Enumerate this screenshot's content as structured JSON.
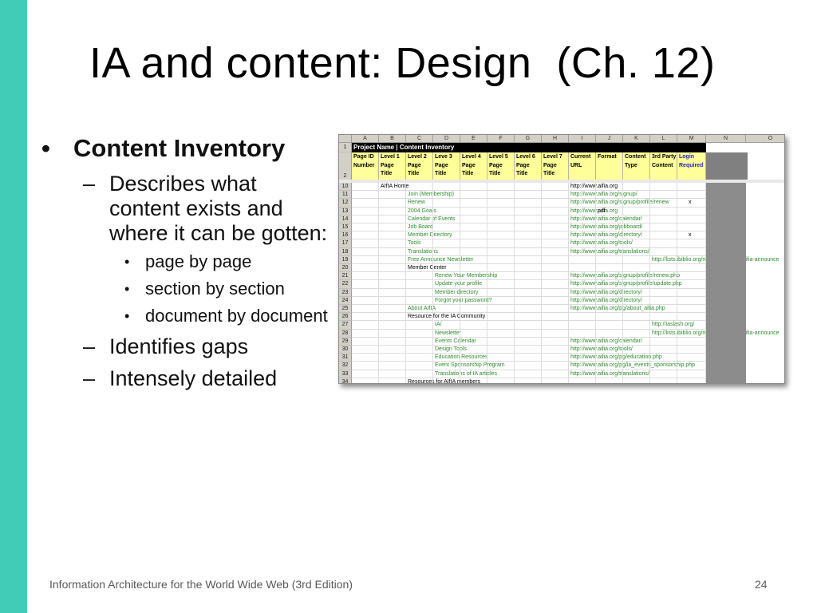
{
  "slide": {
    "title": "IA and content: Design  (Ch. 12)",
    "footer": "Information Architecture for the World Wide Web (3rd Edition)",
    "page_number": "24",
    "accent_color": "#40CCB6"
  },
  "bullets": {
    "l1": "Content Inventory",
    "describes": "Describes what content exists and where it can be gotten:",
    "sub1": "page by page",
    "sub2": "section by section",
    "sub3": "document by document",
    "gaps": "Identifies gaps",
    "detailed": "Intensely detailed"
  },
  "spreadsheet": {
    "columns": [
      "A",
      "B",
      "C",
      "D",
      "E",
      "F",
      "G",
      "H",
      "I",
      "J",
      "K",
      "L",
      "M",
      "N",
      "O"
    ],
    "banner": "Project Name | Content Inventory",
    "headers": [
      [
        "Page ID",
        "Number",
        ""
      ],
      [
        "Level 1",
        "Page",
        "Title"
      ],
      [
        "Level 2",
        "Page",
        "Title"
      ],
      [
        "Leve 3",
        "Page",
        "Title"
      ],
      [
        "Level 4",
        "Page",
        "Title"
      ],
      [
        "Level 5",
        "Page",
        "Title"
      ],
      [
        "Level 6",
        "Page",
        "Title"
      ],
      [
        "Level 7",
        "Page",
        "Title"
      ],
      [
        "Current",
        "URL",
        ""
      ],
      [
        "Format",
        "",
        ""
      ],
      [
        "Content",
        "Type",
        ""
      ],
      [
        "3rd Party",
        "Content",
        ""
      ],
      [
        "Login",
        "Required",
        ""
      ]
    ],
    "header_row_labels": [
      "1",
      "2"
    ],
    "rows": [
      {
        "n": "10",
        "level": 1,
        "title": "AIfIA Home",
        "url": "http://www.aifia.org",
        "fmt": "",
        "login": ""
      },
      {
        "n": "11",
        "level": 2,
        "title": "Join (Membership)",
        "url": "http://www.aifia.org/signup/",
        "fmt": "",
        "login": ""
      },
      {
        "n": "12",
        "level": 2,
        "title": "Renew",
        "url": "http://www.aifia.org/signup/profile/renew",
        "fmt": "",
        "login": "x"
      },
      {
        "n": "13",
        "level": 2,
        "title": "2004 Goals",
        "url": "http://www.aifia.org",
        "fmt": "pdf",
        "login": ""
      },
      {
        "n": "14",
        "level": 2,
        "title": "Calendar of Events",
        "url": "http://www.aifia.org/calendar/",
        "fmt": "",
        "login": ""
      },
      {
        "n": "15",
        "level": 2,
        "title": "Job Board",
        "url": "http://www.aifia.org/jobboard/",
        "fmt": "",
        "login": ""
      },
      {
        "n": "16",
        "level": 2,
        "title": "Member Directory",
        "url": "http://www.aifia.org/directory/",
        "fmt": "",
        "login": "x"
      },
      {
        "n": "17",
        "level": 2,
        "title": "Tools",
        "url": "http://www.aifia.org/tools/",
        "fmt": "",
        "login": ""
      },
      {
        "n": "18",
        "level": 2,
        "title": "Translations",
        "url": "http://www.aifia.org/translations/",
        "fmt": "",
        "login": ""
      },
      {
        "n": "19",
        "level": 2,
        "title": "Free Announce Newsletter",
        "url": "",
        "third": "http://lists.ibiblio.org/mailman/listinfo/aifia-announce",
        "fmt": "",
        "login": ""
      },
      {
        "n": "20",
        "level": 2,
        "title": "Member Center",
        "url": "",
        "fmt": "",
        "login": "",
        "black": true
      },
      {
        "n": "21",
        "level": 3,
        "title": "Renew Your Membership",
        "url": "http://www.aifia.org/signup/profile/renew.php",
        "fmt": "",
        "login": ""
      },
      {
        "n": "22",
        "level": 3,
        "title": "Update your profile",
        "url": "http://www.aifia.org/signup/profile/update.php",
        "fmt": "",
        "login": ""
      },
      {
        "n": "23",
        "level": 3,
        "title": "Member directory",
        "url": "http://www.aifia.org/directory/",
        "fmt": "",
        "login": ""
      },
      {
        "n": "24",
        "level": 3,
        "title": "Forgot your password?",
        "url": "http://www.aifia.org/directory/",
        "fmt": "",
        "login": ""
      },
      {
        "n": "25",
        "level": 2,
        "title": "About AIfIA",
        "url": "http://www.aifia.org/pg/about_aifia.php",
        "fmt": "",
        "login": ""
      },
      {
        "n": "26",
        "level": 2,
        "title": "Resource for the IA Community",
        "url": "",
        "fmt": "",
        "login": "",
        "black": true
      },
      {
        "n": "27",
        "level": 3,
        "title": "IA/",
        "url": "",
        "third": "http://iaslash.org/",
        "fmt": "",
        "login": ""
      },
      {
        "n": "28",
        "level": 3,
        "title": "Newsletter",
        "url": "",
        "third": "http://lists.ibiblio.org/mailman/listinfo/aifia-announce",
        "fmt": "",
        "login": ""
      },
      {
        "n": "29",
        "level": 3,
        "title": "Events Calendar",
        "url": "http://www.aifia.org/calendar/",
        "fmt": "",
        "login": ""
      },
      {
        "n": "30",
        "level": 3,
        "title": "Design Tools",
        "url": "http://www.aifia.org/tools/",
        "fmt": "",
        "login": ""
      },
      {
        "n": "31",
        "level": 3,
        "title": "Education Resources",
        "url": "http://www.aifia.org/pg/education.php",
        "fmt": "",
        "login": ""
      },
      {
        "n": "32",
        "level": 3,
        "title": "Event Sponsorship Program",
        "url": "http://www.aifia.org/pg/ia_events_sponsorship.php",
        "fmt": "",
        "login": ""
      },
      {
        "n": "33",
        "level": 3,
        "title": "Translations of IA articles",
        "url": "http://www.aifia.org/translations/",
        "fmt": "",
        "login": ""
      },
      {
        "n": "34",
        "level": 2,
        "title": "Resources for AIfIA members",
        "url": "",
        "fmt": "",
        "login": "",
        "black": true
      }
    ]
  }
}
